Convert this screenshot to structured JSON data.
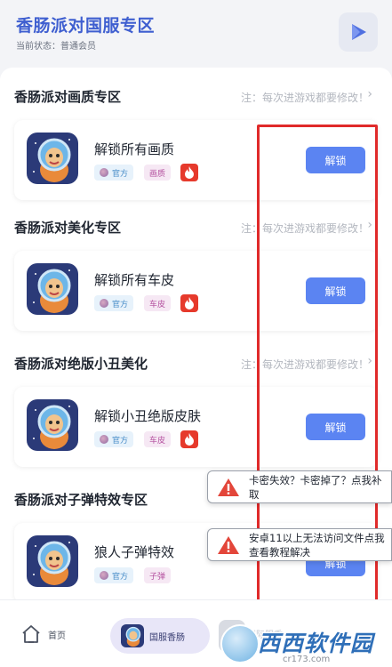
{
  "header": {
    "title": "香肠派对国服专区",
    "status": "当前状态：普通会员",
    "play_icon": "play-triangle-icon"
  },
  "sections": [
    {
      "title": "香肠派对画质专区",
      "note": "注：每次进游戏都要修改！",
      "item": {
        "title": "解锁所有画质",
        "tag_official": "官方",
        "tag_category": "画质",
        "button": "解锁"
      }
    },
    {
      "title": "香肠派对美化专区",
      "note": "注：每次进游戏都要修改！",
      "item": {
        "title": "解锁所有车皮",
        "tag_official": "官方",
        "tag_category": "车皮",
        "button": "解锁"
      }
    },
    {
      "title": "香肠派对绝版小丑美化",
      "note": "注：每次进游戏都要修改！",
      "item": {
        "title": "解锁小丑绝版皮肤",
        "tag_official": "官方",
        "tag_category": "车皮",
        "button": "解锁"
      }
    },
    {
      "title": "香肠派对子弹特效专区",
      "note": "",
      "item": {
        "title": "狼人子弹特效",
        "tag_official": "官方",
        "tag_category": "子弹",
        "button": "解锁"
      }
    }
  ],
  "toasts": [
    {
      "text": "卡密失效？卡密掉了？点我补取",
      "icon": "warning-triangle-icon"
    },
    {
      "text": "安卓11以上无法访问文件点我查看教程解决",
      "icon": "warning-triangle-icon"
    }
  ],
  "tabbar": {
    "home_label": "首页",
    "active_label": "国服香肠",
    "third_label": "国际服香"
  },
  "watermark": {
    "text": "西西软件园",
    "domain": "cr173.com"
  },
  "colors": {
    "accent": "#5b84f2",
    "title_blue": "#3f5fd0",
    "fire": "#e63a2c",
    "highlight_box": "#e02a2a"
  }
}
